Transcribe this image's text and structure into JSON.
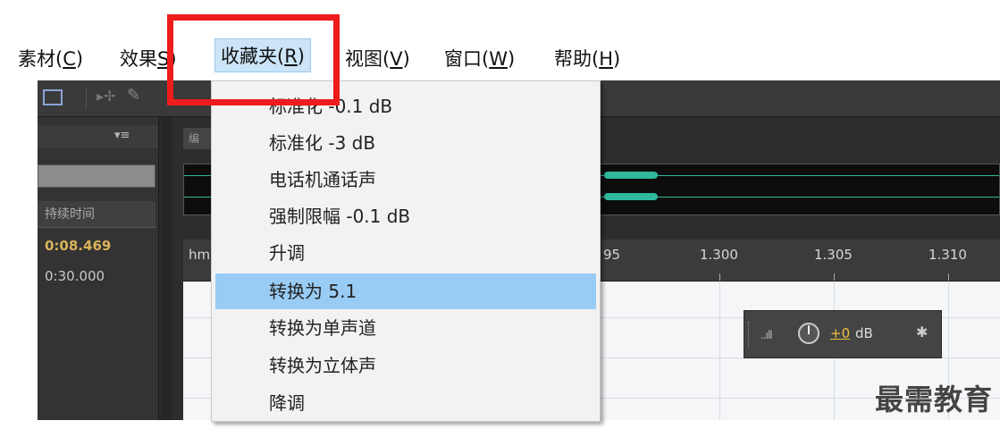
{
  "menubar": {
    "items": [
      {
        "label": "素材(",
        "key": "C",
        "suffix": ")"
      },
      {
        "label": "效果",
        "key": "S",
        "suffix": ")"
      },
      {
        "label": "收藏夹(",
        "key": "R",
        "suffix": ")"
      },
      {
        "label": "视图(",
        "key": "V",
        "suffix": ")"
      },
      {
        "label": "窗口(",
        "key": "W",
        "suffix": ")"
      },
      {
        "label": "帮助(",
        "key": "H",
        "suffix": ")"
      }
    ]
  },
  "files_panel": {
    "column_header": "持续时间",
    "rows": [
      {
        "duration": "0:08.469"
      },
      {
        "duration": "0:30.000"
      }
    ]
  },
  "editor": {
    "tab_label": "编",
    "ruler_prefix": "hm",
    "ruler_labels": [
      "95",
      "1.300",
      "1.305",
      "1.310"
    ]
  },
  "hud": {
    "value": "+0",
    "unit": "dB"
  },
  "favorites_menu": {
    "items": [
      {
        "label": "标准化 -0.1 dB",
        "selected": false
      },
      {
        "label": "标准化 -3 dB",
        "selected": false
      },
      {
        "label": "电话机通话声",
        "selected": false
      },
      {
        "label": "强制限幅 -0.1 dB",
        "selected": false
      },
      {
        "label": "升调",
        "selected": false
      },
      {
        "label": "转换为 5.1",
        "selected": true
      },
      {
        "label": "转换为单声道",
        "selected": false
      },
      {
        "label": "转换为立体声",
        "selected": false
      },
      {
        "label": "降调",
        "selected": false
      }
    ]
  },
  "watermark": "最需教育",
  "colors": {
    "highlight_box": "#ee1c1c",
    "selected_item": "#99ccf5",
    "waveform": "#2fb89c",
    "duration_highlight": "#d9b35a"
  }
}
